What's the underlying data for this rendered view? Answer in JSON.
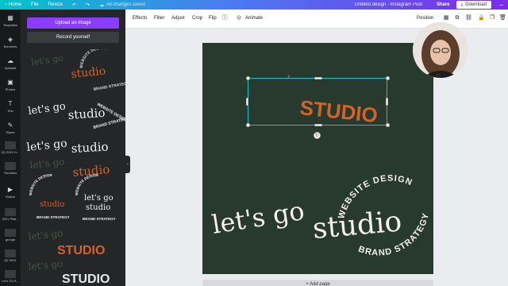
{
  "topbar": {
    "home": "Home",
    "file": "File",
    "resize": "Resize",
    "saved": "All changes saved",
    "title": "Untitled design - Instagram Post",
    "share": "Share",
    "download": "Download",
    "more": "..."
  },
  "rail": {
    "items": [
      {
        "label": "Templates",
        "icon": "templates-icon"
      },
      {
        "label": "Elements",
        "icon": "elements-icon"
      },
      {
        "label": "Uploads",
        "icon": "uploads-icon"
      },
      {
        "label": "Photos",
        "icon": "photos-icon"
      },
      {
        "label": "Text",
        "icon": "text-icon"
      },
      {
        "label": "Styles",
        "icon": "styles-icon"
      },
      {
        "label": "Q1 2021 H...",
        "icon": "folder-thumb"
      },
      {
        "label": "Tornados",
        "icon": "folder-thumb"
      },
      {
        "label": "Videos",
        "icon": "videos-icon"
      },
      {
        "label": "2021 Plati...",
        "icon": "folder-thumb"
      },
      {
        "label": "grunge",
        "icon": "folder-thumb"
      },
      {
        "label": "Q2 2021",
        "icon": "folder-thumb"
      },
      {
        "label": "Let's Go S...",
        "icon": "folder-thumb"
      }
    ]
  },
  "panel": {
    "upload_label": "Upload an image",
    "record_label": "Record yourself",
    "thumb_lets": "let's go",
    "thumb_studio": "studio",
    "thumb_studio_caps": "STUDIO",
    "thumb_website": "WEBSITE DESIGN",
    "thumb_brand": "BRAND STRATEGY"
  },
  "toolbar": {
    "effects": "Effects",
    "filter": "Filter",
    "adjust": "Adjust",
    "crop": "Crop",
    "flip": "Flip",
    "animate": "Animate",
    "position": "Position"
  },
  "canvas": {
    "background": "#283a2d",
    "accent": "#d4622b",
    "selected_text": "STUDIO",
    "lets_go": "let's go",
    "studio": "studio",
    "website_design": "WEBSITE DESIGN",
    "brand_strategy": "BRAND STRATEGY",
    "add_page": "+ Add page"
  }
}
